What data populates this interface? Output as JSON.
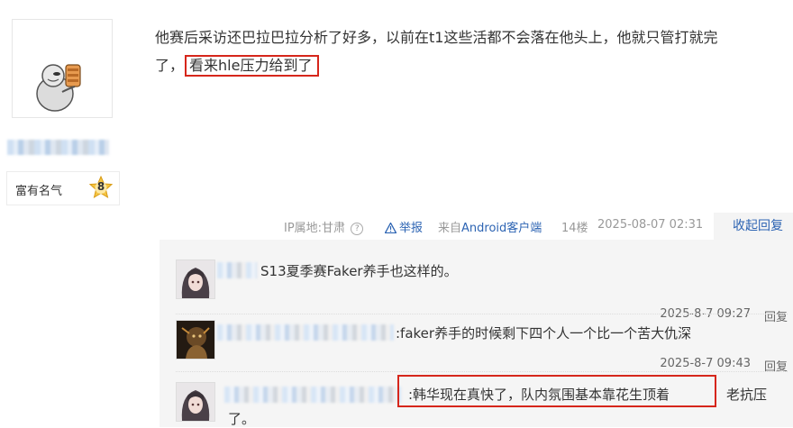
{
  "post": {
    "text_line1": "他赛后采访还巴拉巴拉分析了好多，以前在t1这些活都不会落在他头上，他就只管打就完",
    "text_line2_start": "了，",
    "text_highlight": "看来hle压力给到了"
  },
  "user": {
    "fame_label": "富有名气",
    "level": "8"
  },
  "meta": {
    "ip": "IP属地:甘肃",
    "help_icon": "?",
    "report": "举报",
    "source_prefix": "来自",
    "source_app": "Android客户端",
    "floor": "14楼",
    "time": "2025-08-07 02:31",
    "collapse": "收起回复"
  },
  "replies": [
    {
      "text": "S13夏季赛Faker养手也这样的。",
      "time": "2025-8-7 09:27",
      "reply": "回复"
    },
    {
      "text": ":faker养手的时候剩下四个人一个比一个苦大仇深",
      "time": "2025-8-7 09:43",
      "reply": "回复"
    },
    {
      "text_boxed": ":韩华现在真快了，队内氛围基本靠花生顶着",
      "text_after": "老抗压",
      "text_line2": "了。"
    }
  ],
  "colors": {
    "link": "#2d64b3",
    "highlight_border": "#d6261b",
    "reply_bg": "#f5f5f5"
  },
  "icons": [
    "user-avatar-cartoon",
    "level-badge",
    "help-icon",
    "warning-icon",
    "reply-avatar"
  ]
}
